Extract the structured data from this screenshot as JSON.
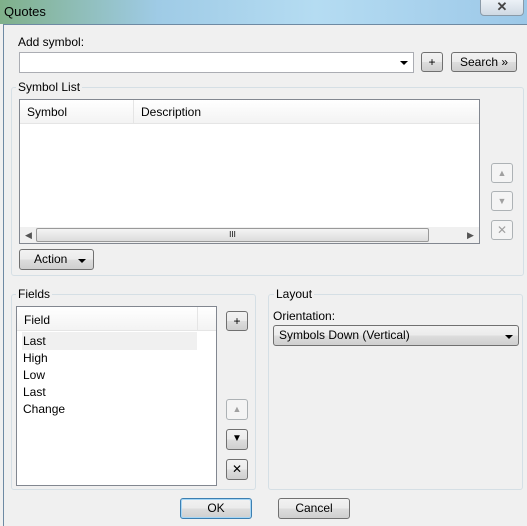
{
  "window": {
    "title": "Quotes",
    "close_icon": "close-icon"
  },
  "add_symbol": {
    "label": "Add symbol:",
    "value": "",
    "add_label": "+",
    "search_label": "Search »"
  },
  "symbol_list": {
    "group_label": "Symbol List",
    "columns": [
      "Symbol",
      "Description"
    ],
    "rows": [],
    "scrollbar_grip": "III",
    "action_label": "Action"
  },
  "fields": {
    "group_label": "Fields",
    "column": "Field",
    "items": [
      "Last",
      "High",
      "Low",
      "Last",
      "Change"
    ],
    "selected_index": 0,
    "add_label": "+"
  },
  "layout": {
    "group_label": "Layout",
    "orientation_label": "Orientation:",
    "orientation_value": "Symbols Down (Vertical)"
  },
  "footer": {
    "ok_label": "OK",
    "cancel_label": "Cancel"
  }
}
